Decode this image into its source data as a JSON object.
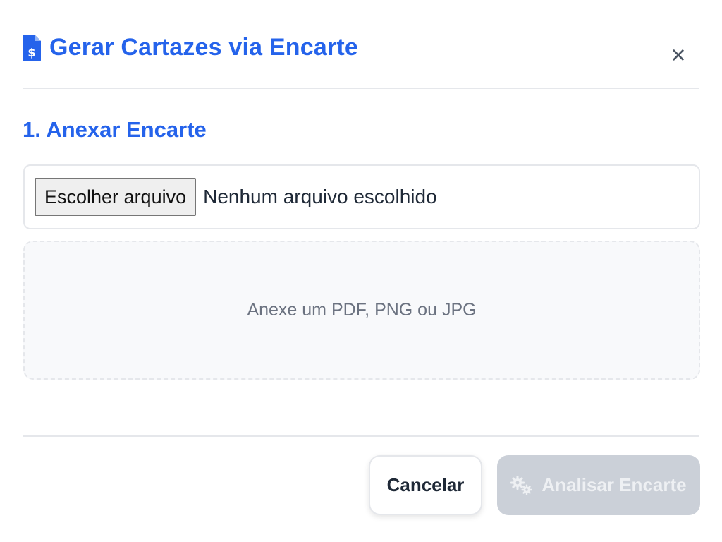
{
  "dialog": {
    "title": "Gerar Cartazes via Encarte",
    "title_icon": "file-invoice-dollar-icon",
    "close_label": "×",
    "close_icon": "close-icon"
  },
  "step1": {
    "heading": "1. Anexar Encarte",
    "file_button_label": "Escolher arquivo",
    "file_status": "Nenhum arquivo escolhido",
    "drop_hint": "Anexe um PDF, PNG ou JPG"
  },
  "footer": {
    "cancel_label": "Cancelar",
    "analyze_label": "Analisar Encarte",
    "analyze_icon": "cogs-icon",
    "analyze_disabled": true
  },
  "colors": {
    "accent": "#2563eb",
    "disabled_button": "#cbd0d8",
    "border": "#e5e7eb",
    "muted_text": "#6b7280"
  }
}
